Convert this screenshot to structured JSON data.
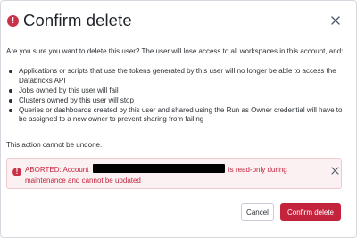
{
  "dialog": {
    "title": "Confirm delete",
    "title_icon": "error-circle-icon",
    "close_icon": "close-icon",
    "intro": "Are you sure you want to delete this user? The user will lose access to all workspaces in this account, and:",
    "bullets": [
      "Applications or scripts that use the tokens generated by this user will no longer be able to access the Databricks API",
      "Jobs owned by this user will fail",
      "Clusters owned by this user will stop",
      "Queries or dashboards created by this user and shared using the Run as Owner credential will have to be assigned to a new owner to prevent sharing from failing"
    ],
    "undone": "This action cannot be undone."
  },
  "alert": {
    "icon": "error-circle-icon",
    "prefix": "ABORTED: Account",
    "suffix": "is read-only during maintenance and cannot be updated",
    "close_icon": "close-icon"
  },
  "footer": {
    "cancel_label": "Cancel",
    "confirm_label": "Confirm delete"
  },
  "colors": {
    "danger": "#c4233d",
    "alert_bg": "#fbf1f2",
    "alert_border": "#f0c9cf"
  }
}
